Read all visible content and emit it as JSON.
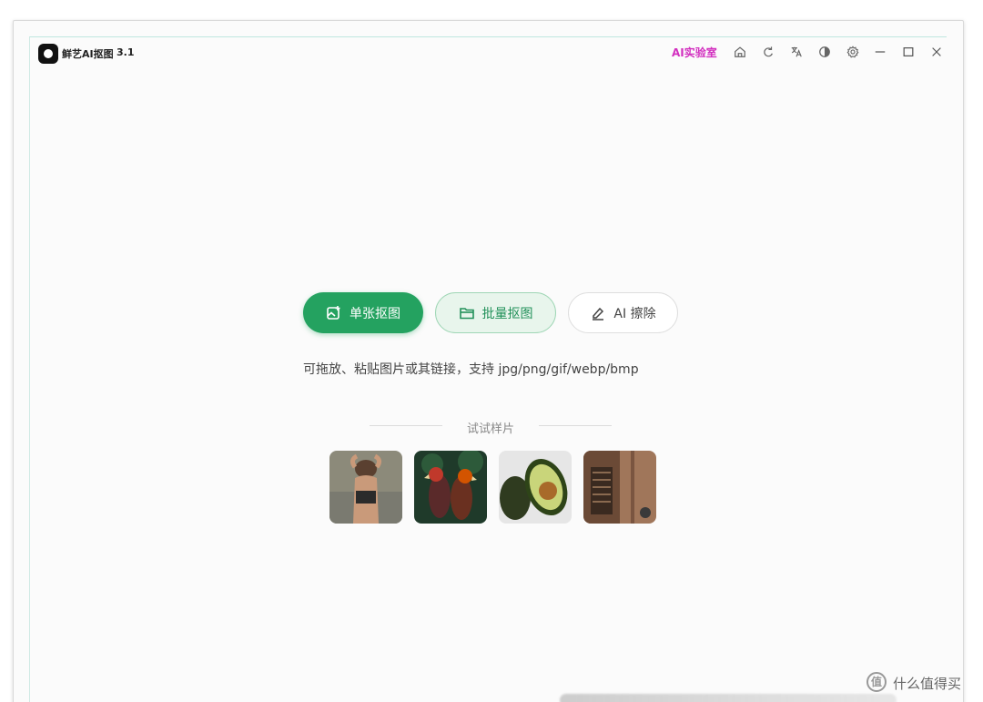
{
  "app": {
    "title": "鲜艺AI抠图",
    "version": "3.1"
  },
  "titlebar": {
    "ai_lab": "AI实验室",
    "icons": [
      "home-icon",
      "refresh-icon",
      "translate-icon",
      "theme-icon",
      "gear-icon",
      "minimize-icon",
      "maximize-icon",
      "close-icon"
    ]
  },
  "actions": {
    "single_label": "单张抠图",
    "batch_label": "批量抠图",
    "erase_label": "AI 擦除"
  },
  "hint": "可拖放、粘贴图片或其链接，支持 jpg/png/gif/webp/bmp",
  "samples": {
    "title": "试试样片",
    "items": [
      "sample-person",
      "sample-parrots",
      "sample-avocado",
      "sample-interior"
    ]
  },
  "watermark": {
    "badge": "值",
    "text": "什么值得买"
  },
  "colors": {
    "primary": "#24a260",
    "ai_lab": "#d22fbf"
  }
}
